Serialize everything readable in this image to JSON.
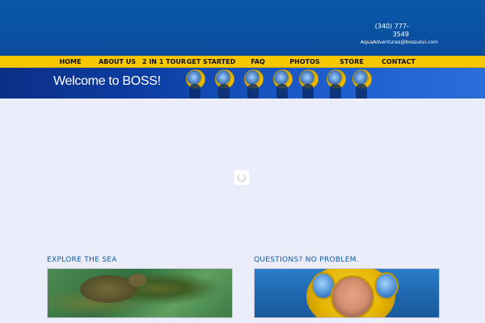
{
  "header": {
    "phone": "(340) 777-3549",
    "email": "AquaAdventures@bossusvi.com"
  },
  "nav": {
    "items": [
      {
        "label": "HOME"
      },
      {
        "label": "ABOUT US"
      },
      {
        "label": "2 IN 1 TOUR"
      },
      {
        "label": "GET STARTED"
      },
      {
        "label": "FAQ"
      },
      {
        "label": "PHOTOS"
      },
      {
        "label": "STORE"
      },
      {
        "label": "CONTACT"
      }
    ]
  },
  "banner": {
    "title": "Welcome to BOSS!"
  },
  "sections": {
    "left": {
      "title": "EXPLORE THE SEA"
    },
    "right": {
      "title": "QUESTIONS? NO PROBLEM."
    }
  },
  "icons": {
    "loading": "loading-spinner-icon"
  }
}
